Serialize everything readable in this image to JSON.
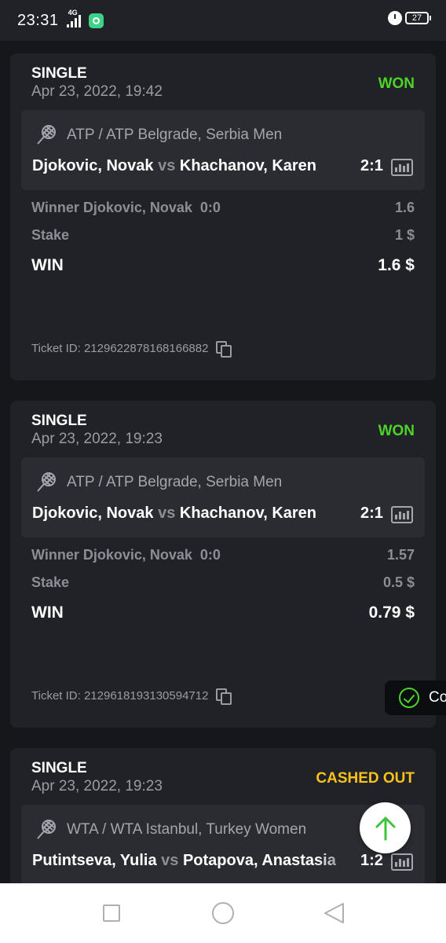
{
  "status_bar": {
    "time": "23:31",
    "network": "4G",
    "battery": "27"
  },
  "bets": [
    {
      "type": "SINGLE",
      "date": "Apr 23, 2022, 19:42",
      "status": "WON",
      "league": "ATP / ATP Belgrade, Serbia Men",
      "home": "Djokovic, Novak",
      "vs": "vs",
      "away": "Khachanov, Karen",
      "score": "2:1",
      "selection": "Winner Djokovic, Novak",
      "selection_score": "0:0",
      "odds": "1.6",
      "stake_label": "Stake",
      "stake": "1 $",
      "win_label": "WIN",
      "win": "1.6 $",
      "ticket": "Ticket ID: 2129622878168166882"
    },
    {
      "type": "SINGLE",
      "date": "Apr 23, 2022, 19:23",
      "status": "WON",
      "league": "ATP / ATP Belgrade, Serbia Men",
      "home": "Djokovic, Novak",
      "vs": "vs",
      "away": "Khachanov, Karen",
      "score": "2:1",
      "selection": "Winner Djokovic, Novak",
      "selection_score": "0:0",
      "odds": "1.57",
      "stake_label": "Stake",
      "stake": "0.5 $",
      "win_label": "WIN",
      "win": "0.79 $",
      "ticket": "Ticket ID: 2129618193130594712"
    },
    {
      "type": "SINGLE",
      "date": "Apr 23, 2022, 19:23",
      "status": "CASHED OUT",
      "league": "WTA / WTA Istanbul, Turkey Women",
      "home": "Putintseva, Yulia",
      "vs": "vs",
      "away": "Potapova, Anastasia",
      "score": "1:2"
    }
  ],
  "toast": {
    "text": "Co"
  },
  "colors": {
    "won": "#4cd327",
    "cashed_out": "#f7c21a",
    "card_bg": "#212227"
  },
  "icons": {
    "sport": "tennis-racket-icon",
    "stats": "bar-chart-icon",
    "copy": "copy-icon",
    "scroll_top": "arrow-up-icon"
  }
}
